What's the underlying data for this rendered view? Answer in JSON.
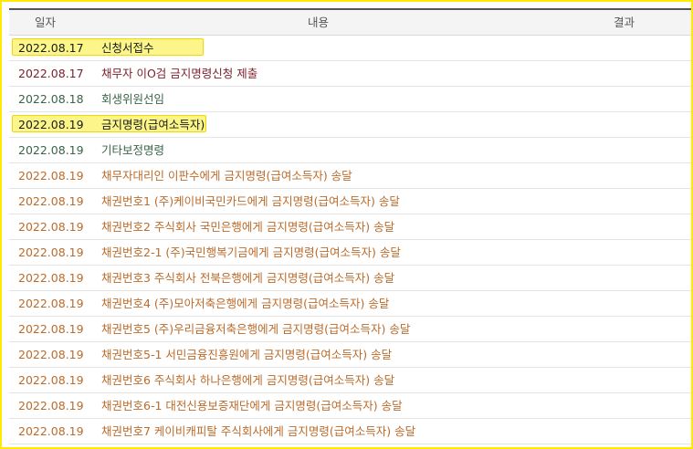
{
  "header": {
    "date": "일자",
    "content": "내용",
    "result": "결과"
  },
  "colors": {
    "frame_border": "#ffea00",
    "highlight_fill": "#fbf58a",
    "text_black": "#1a1a1a",
    "text_maroon": "#7a1e2a",
    "text_green": "#3a6448",
    "text_orange": "#bb6b2b"
  },
  "rows": [
    {
      "date": "2022.08.17",
      "content": "신청서접수",
      "result": "",
      "color": "black",
      "highlighted": true
    },
    {
      "date": "2022.08.17",
      "content": "채무자 이O검 금지명령신청 제출",
      "result": "",
      "color": "maroon",
      "highlighted": false
    },
    {
      "date": "2022.08.18",
      "content": "회생위원선임",
      "result": "",
      "color": "green",
      "highlighted": false
    },
    {
      "date": "2022.08.19",
      "content": "금지명령(급여소득자)",
      "result": "",
      "color": "black",
      "highlighted": true
    },
    {
      "date": "2022.08.19",
      "content": "기타보정명령",
      "result": "",
      "color": "green",
      "highlighted": false
    },
    {
      "date": "2022.08.19",
      "content": "채무자대리인 이판수에게 금지명령(급여소득자) 송달",
      "result": "",
      "color": "orange",
      "highlighted": false
    },
    {
      "date": "2022.08.19",
      "content": "채권번호1 (주)케이비국민카드에게 금지명령(급여소득자) 송달",
      "result": "",
      "color": "orange",
      "highlighted": false
    },
    {
      "date": "2022.08.19",
      "content": "채권번호2 주식회사 국민은행에게 금지명령(급여소득자) 송달",
      "result": "",
      "color": "orange",
      "highlighted": false
    },
    {
      "date": "2022.08.19",
      "content": "채권번호2-1 (주)국민행복기금에게 금지명령(급여소득자) 송달",
      "result": "",
      "color": "orange",
      "highlighted": false
    },
    {
      "date": "2022.08.19",
      "content": "채권번호3 주식회사 전북은행에게 금지명령(급여소득자) 송달",
      "result": "",
      "color": "orange",
      "highlighted": false
    },
    {
      "date": "2022.08.19",
      "content": "채권번호4 (주)모아저축은행에게 금지명령(급여소득자) 송달",
      "result": "",
      "color": "orange",
      "highlighted": false
    },
    {
      "date": "2022.08.19",
      "content": "채권번호5 (주)우리금융저축은행에게 금지명령(급여소득자) 송달",
      "result": "",
      "color": "orange",
      "highlighted": false
    },
    {
      "date": "2022.08.19",
      "content": "채권번호5-1 서민금융진흥원에게 금지명령(급여소득자) 송달",
      "result": "",
      "color": "orange",
      "highlighted": false
    },
    {
      "date": "2022.08.19",
      "content": "채권번호6 주식회사 하나은행에게 금지명령(급여소득자) 송달",
      "result": "",
      "color": "orange",
      "highlighted": false
    },
    {
      "date": "2022.08.19",
      "content": "채권번호6-1 대전신용보증재단에게 금지명령(급여소득자) 송달",
      "result": "",
      "color": "orange",
      "highlighted": false
    },
    {
      "date": "2022.08.19",
      "content": "채권번호7 케이비캐피탈 주식회사에게 금지명령(급여소득자) 송달",
      "result": "",
      "color": "orange",
      "highlighted": false
    }
  ]
}
